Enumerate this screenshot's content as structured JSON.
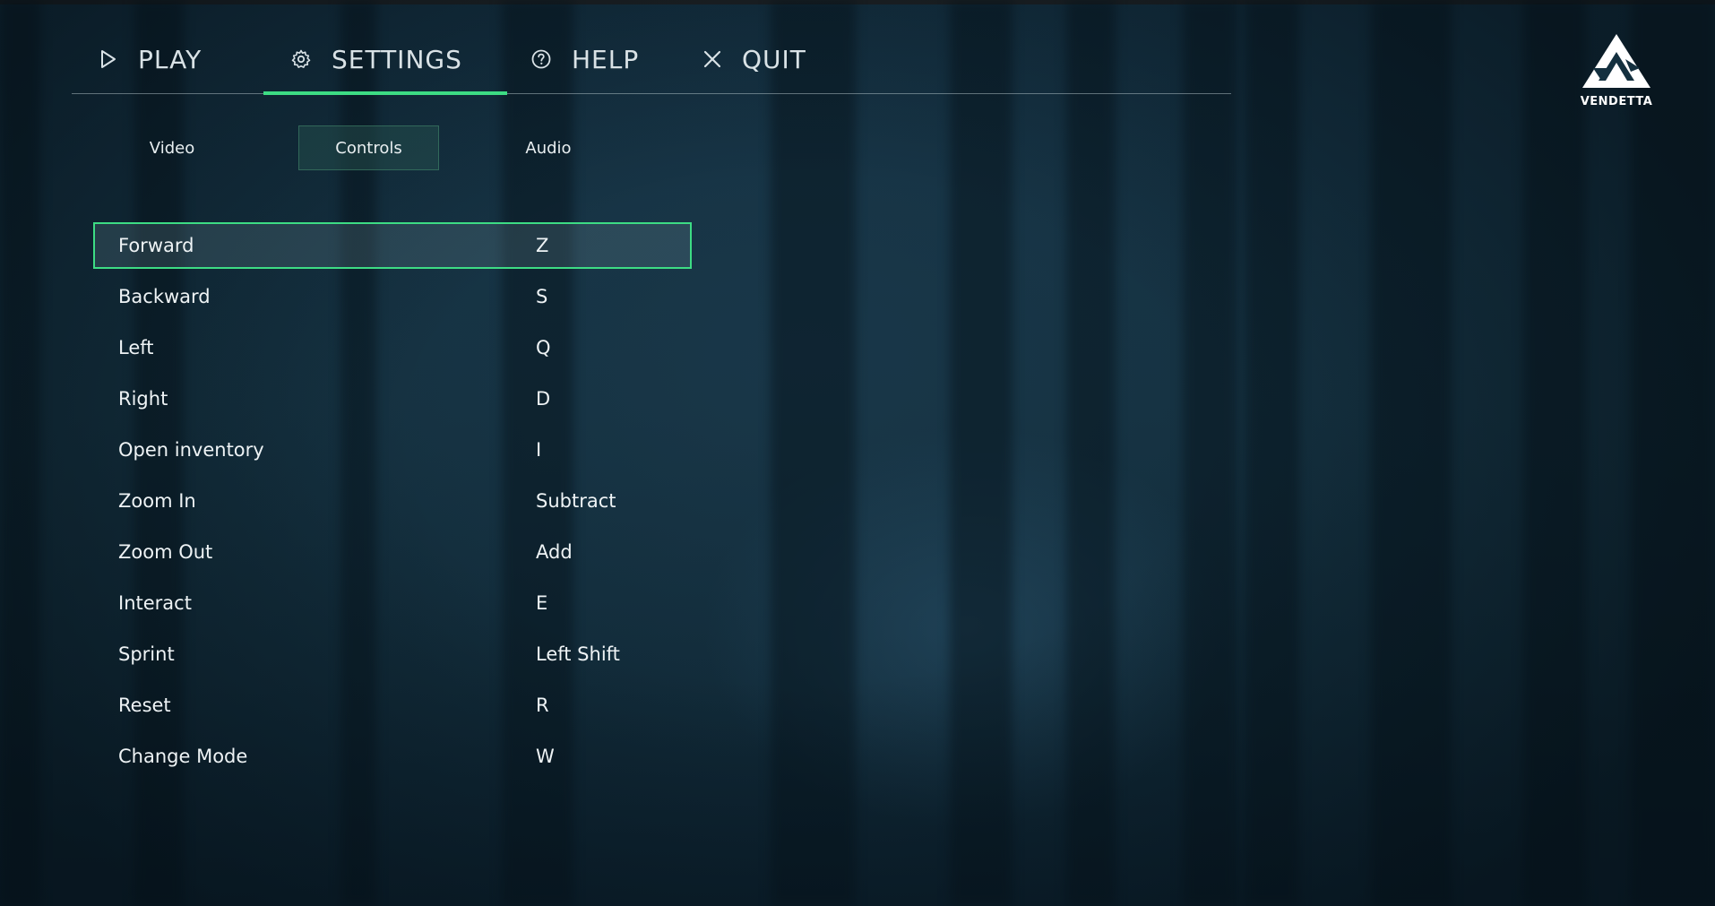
{
  "nav": {
    "items": [
      {
        "label": "PLAY",
        "icon": "play-icon"
      },
      {
        "label": "SETTINGS",
        "icon": "gear-icon",
        "active": true
      },
      {
        "label": "HELP",
        "icon": "help-icon"
      },
      {
        "label": "QUIT",
        "icon": "close-icon"
      }
    ]
  },
  "logo": {
    "text": "VENDETTA"
  },
  "subtabs": [
    {
      "label": "Video"
    },
    {
      "label": "Controls",
      "active": true
    },
    {
      "label": "Audio"
    }
  ],
  "controls": [
    {
      "action": "Forward",
      "key": "Z",
      "selected": true
    },
    {
      "action": "Backward",
      "key": "S"
    },
    {
      "action": "Left",
      "key": "Q"
    },
    {
      "action": "Right",
      "key": "D"
    },
    {
      "action": "Open inventory",
      "key": "I"
    },
    {
      "action": "Zoom In",
      "key": "Subtract"
    },
    {
      "action": "Zoom Out",
      "key": "Add"
    },
    {
      "action": "Interact",
      "key": "E"
    },
    {
      "action": "Sprint",
      "key": "Left Shift"
    },
    {
      "action": "Reset",
      "key": "R"
    },
    {
      "action": "Change Mode",
      "key": "W"
    }
  ],
  "colors": {
    "accent": "#3ddc84",
    "background": "#14303f"
  }
}
